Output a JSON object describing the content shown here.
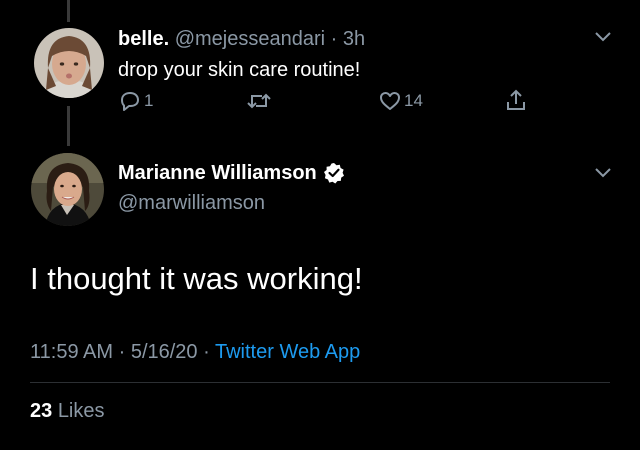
{
  "reply_tweet": {
    "display_name": "belle.",
    "handle": "@mejesseandari",
    "separator": "·",
    "time": "3h",
    "text": "drop your skin care routine!",
    "reply_count": "1",
    "retweet_count": "",
    "like_count": "14"
  },
  "main_tweet": {
    "display_name": "Marianne Williamson",
    "handle": "@marwilliamson",
    "verified": true,
    "text": "I thought it was working!",
    "time": "11:59 AM",
    "dot1": "·",
    "date": "5/16/20",
    "dot2": "·",
    "source": "Twitter Web App",
    "likes_count": "23",
    "likes_label": "Likes"
  },
  "colors": {
    "background": "#000000",
    "muted": "#8b98a5",
    "link": "#1d9bf0",
    "verified_badge": "#ffffff"
  },
  "icons": {
    "reply": "reply-icon",
    "retweet": "retweet-icon",
    "like": "heart-icon",
    "share": "share-icon",
    "more": "chevron-down-icon",
    "verified": "verified-badge-icon"
  }
}
